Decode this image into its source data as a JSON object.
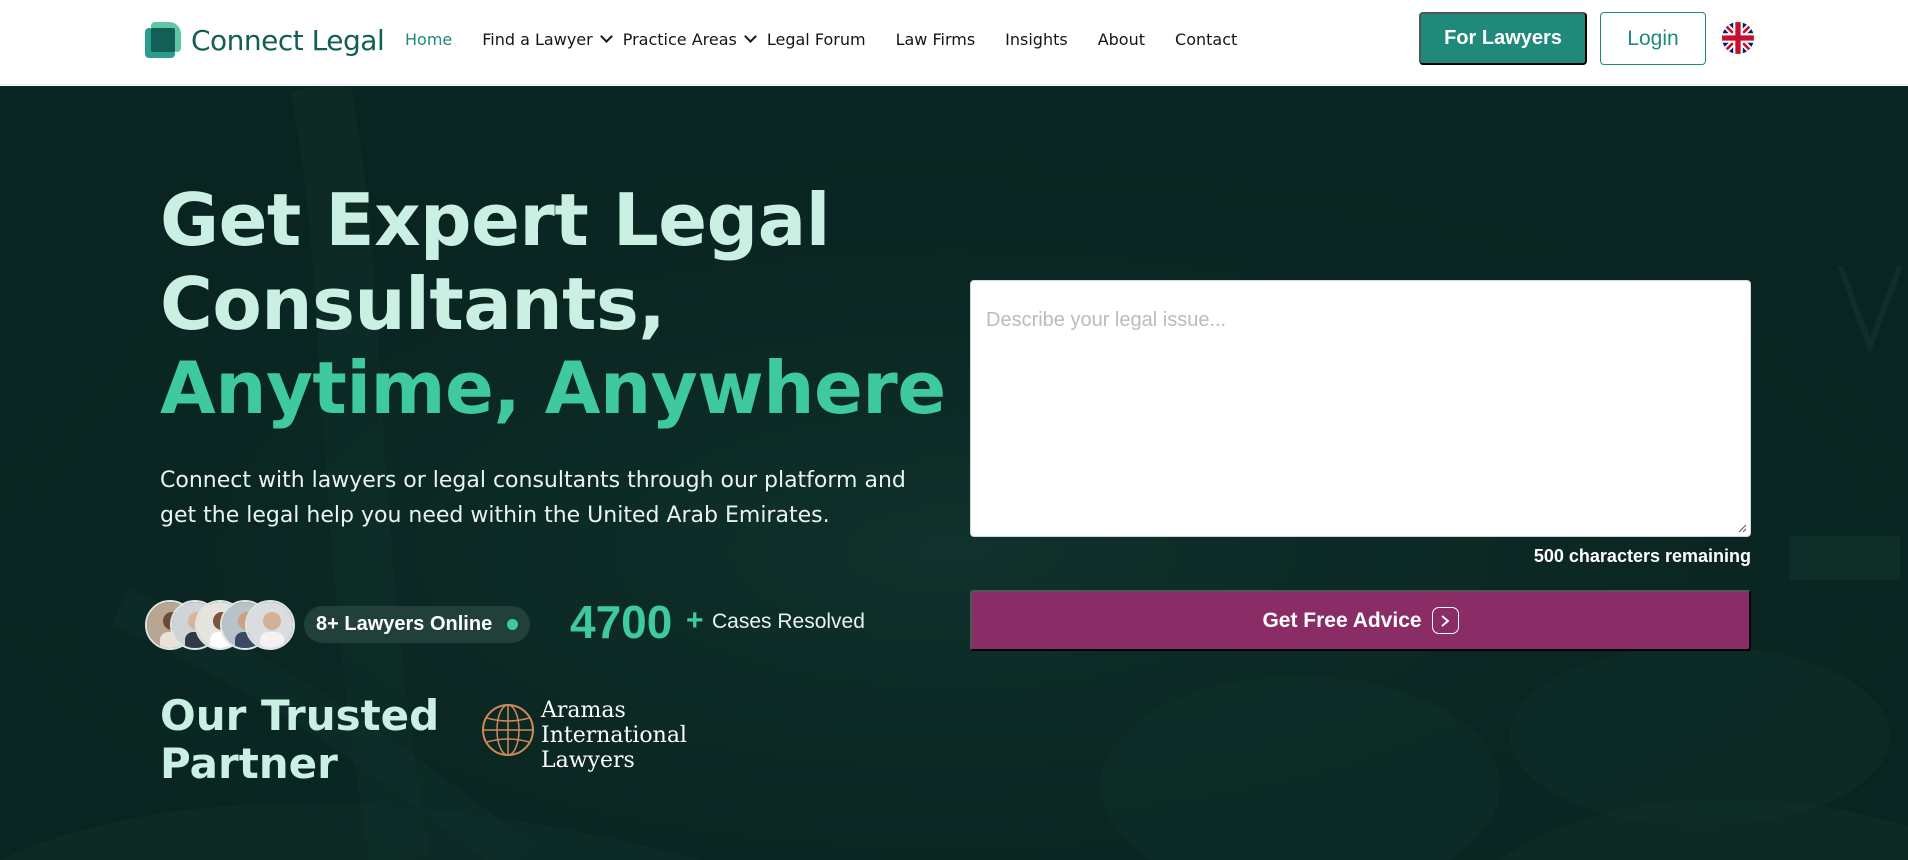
{
  "brand": {
    "name": "Connect Legal"
  },
  "nav": {
    "items": [
      {
        "label": "Home",
        "active": true,
        "dropdown": false
      },
      {
        "label": "Find a Lawyer",
        "active": false,
        "dropdown": true
      },
      {
        "label": "Practice Areas",
        "active": false,
        "dropdown": true
      },
      {
        "label": "Legal Forum",
        "active": false,
        "dropdown": false
      },
      {
        "label": "Law Firms",
        "active": false,
        "dropdown": false
      },
      {
        "label": "Insights",
        "active": false,
        "dropdown": false
      },
      {
        "label": "About",
        "active": false,
        "dropdown": false
      },
      {
        "label": "Contact",
        "active": false,
        "dropdown": false
      }
    ],
    "for_lawyers_label": "For Lawyers",
    "login_label": "Login",
    "language_icon": "uk-flag-icon"
  },
  "hero": {
    "headline_line1": "Get Expert Legal",
    "headline_line2": "Consultants,",
    "headline_line3": "Anytime, Anywhere",
    "subtext": "Connect with lawyers or legal consultants through our platform and get the legal help you need within the United Arab Emirates.",
    "lawyers_online": "8+ Lawyers Online",
    "cases_count": "4700",
    "cases_plus": "+",
    "cases_label": "Cases Resolved",
    "partner_title": "Our Trusted Partner",
    "partner_name_line1": "Aramas",
    "partner_name_line2": "International",
    "partner_name_line3": "Lawyers"
  },
  "form": {
    "issue_placeholder": "Describe your legal issue...",
    "issue_value": "",
    "chars_remaining": "500 characters remaining",
    "submit_label": "Get Free Advice"
  },
  "colors": {
    "primary": "#1f8a7a",
    "accent_green": "#3ec99e",
    "hero_bg": "#0a2521",
    "cta": "#8a2c66"
  }
}
